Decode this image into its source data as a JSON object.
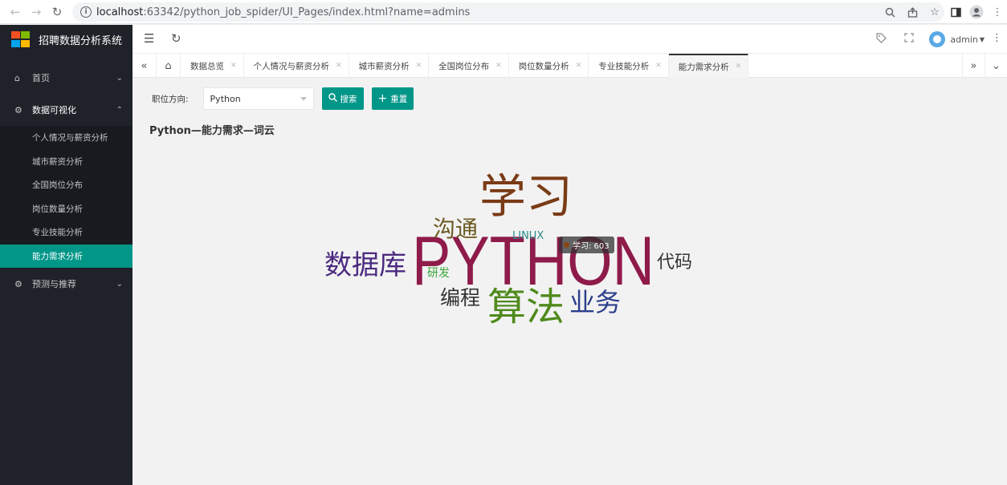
{
  "browser": {
    "url_host": "localhost",
    "url_path": ":63342/python_job_spider/UI_Pages/index.html?name=admins"
  },
  "app": {
    "title": "招聘数据分析系统",
    "user": "admin"
  },
  "sidebar": {
    "items": [
      {
        "label": "首页"
      },
      {
        "label": "数据可视化"
      },
      {
        "label": "预测与推荐"
      }
    ],
    "subitems": [
      {
        "label": "个人情况与薪资分析"
      },
      {
        "label": "城市薪资分析"
      },
      {
        "label": "全国岗位分布"
      },
      {
        "label": "岗位数量分析"
      },
      {
        "label": "专业技能分析"
      },
      {
        "label": "能力需求分析"
      }
    ]
  },
  "tabs": [
    {
      "label": "数据总览"
    },
    {
      "label": "个人情况与薪资分析"
    },
    {
      "label": "城市薪资分析"
    },
    {
      "label": "全国岗位分布"
    },
    {
      "label": "岗位数量分析"
    },
    {
      "label": "专业技能分析"
    },
    {
      "label": "能力需求分析"
    }
  ],
  "filter": {
    "label": "职位方向:",
    "selected": "Python",
    "search_label": "搜索",
    "reset_label": "重置"
  },
  "chart_title": "Python—能力需求—词云",
  "tooltip": "学习: 603",
  "chart_data": {
    "type": "wordcloud",
    "words": [
      {
        "text": "PYTHON",
        "color": "#8e1b4a"
      },
      {
        "text": "学习",
        "value": 603,
        "color": "#7a3b16"
      },
      {
        "text": "算法",
        "color": "#4f8a1c"
      },
      {
        "text": "数据库",
        "color": "#4b2a80"
      },
      {
        "text": "沟通",
        "color": "#6b5a22"
      },
      {
        "text": "业务",
        "color": "#2c3e8c"
      },
      {
        "text": "编程",
        "color": "#333333"
      },
      {
        "text": "代码",
        "color": "#333333"
      },
      {
        "text": "LINUX",
        "color": "#2a8a8a"
      },
      {
        "text": "研发",
        "color": "#3aa63a"
      }
    ]
  }
}
